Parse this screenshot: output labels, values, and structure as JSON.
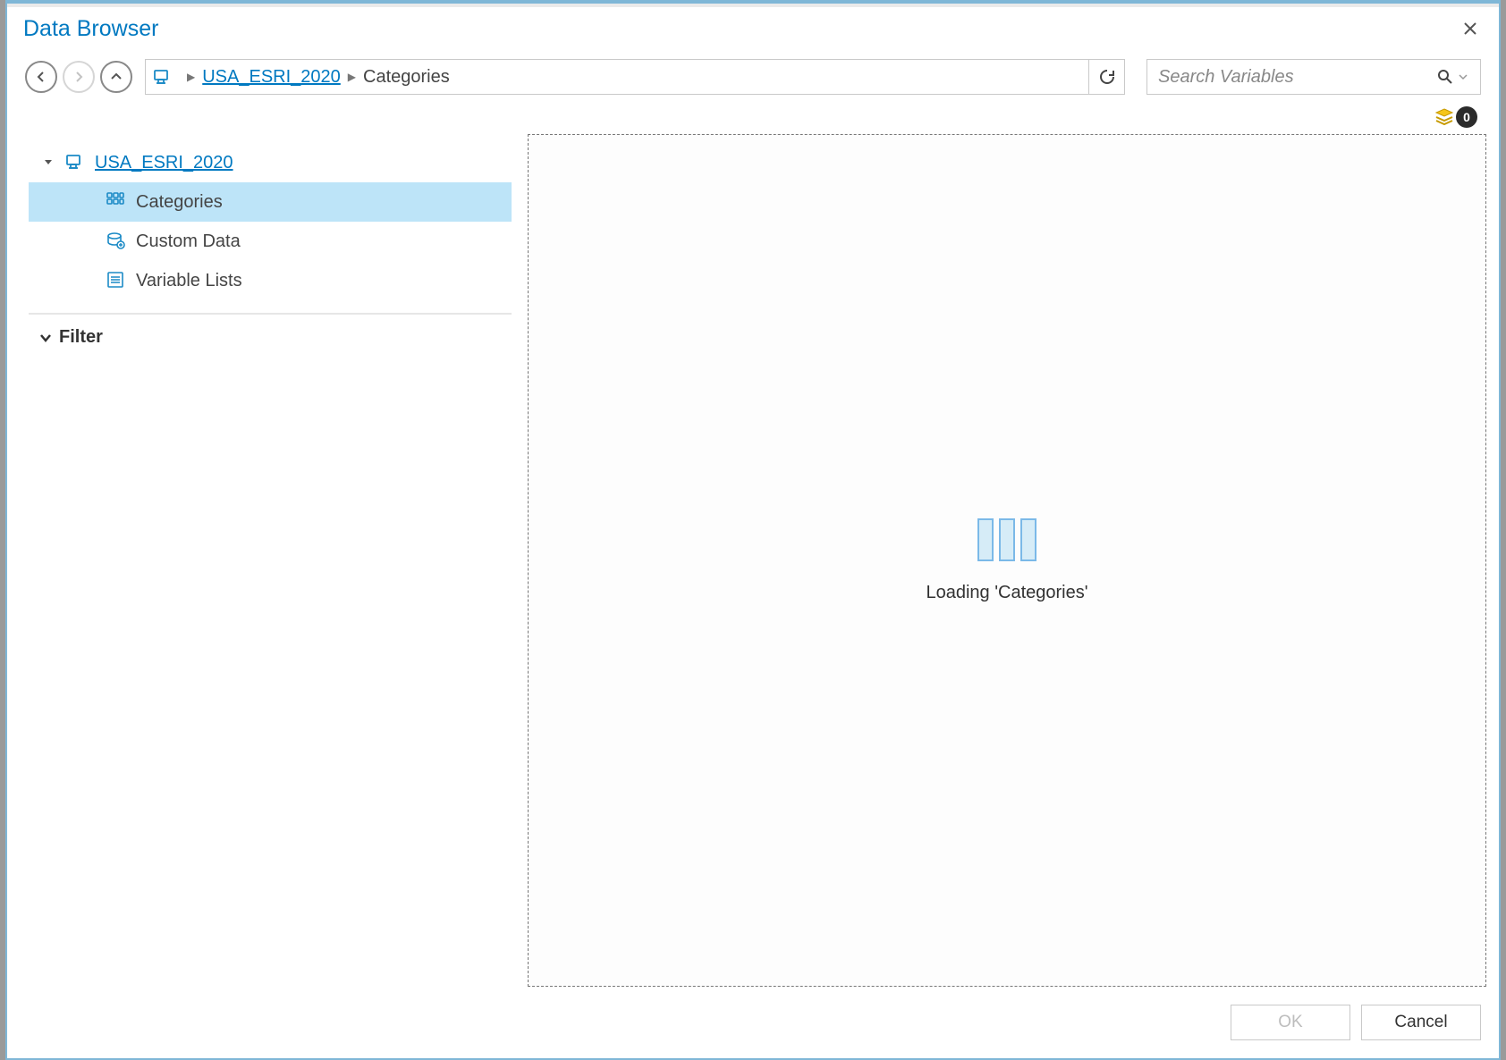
{
  "window": {
    "title": "Data Browser"
  },
  "toolbar": {
    "database_link": "USA_ESRI_2020",
    "crumb_current": "Categories"
  },
  "search": {
    "placeholder": "Search Variables",
    "value": ""
  },
  "selection_badge": {
    "count": "0"
  },
  "tree": {
    "root_label": "USA_ESRI_2020",
    "items": [
      {
        "label": "Categories",
        "selected": true
      },
      {
        "label": "Custom Data",
        "selected": false
      },
      {
        "label": "Variable Lists",
        "selected": false
      }
    ]
  },
  "sidebar": {
    "filter_label": "Filter"
  },
  "content": {
    "loading_text": "Loading 'Categories'"
  },
  "footer": {
    "ok_label": "OK",
    "cancel_label": "Cancel"
  }
}
